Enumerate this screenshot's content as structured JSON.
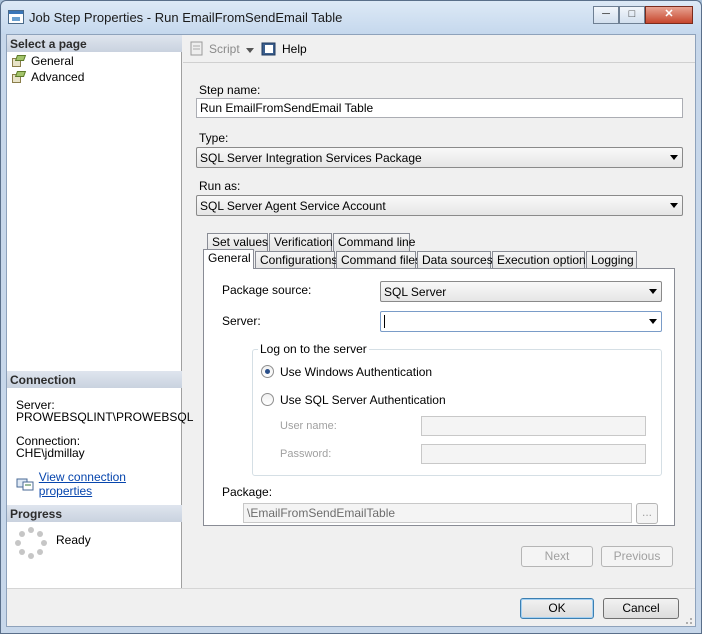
{
  "window": {
    "title": "Job Step Properties - Run EmailFromSendEmail Table"
  },
  "left": {
    "select_page_header": "Select a page",
    "pages": [
      {
        "label": "General"
      },
      {
        "label": "Advanced"
      }
    ],
    "connection_header": "Connection",
    "server_label": "Server:",
    "server_value": "PROWEBSQLINT\\PROWEBSQL",
    "connection_label": "Connection:",
    "connection_value": "CHE\\jdmillay",
    "view_connection_properties": "View connection properties",
    "progress_header": "Progress",
    "progress_status": "Ready"
  },
  "toolbar": {
    "script_label": "Script",
    "help_label": "Help"
  },
  "form": {
    "step_name_label": "Step name:",
    "step_name_value": "Run EmailFromSendEmail Table",
    "type_label": "Type:",
    "type_value": "SQL Server Integration Services Package",
    "run_as_label": "Run as:",
    "run_as_value": "SQL Server Agent Service Account"
  },
  "tabs": {
    "row1": [
      "Set values",
      "Verification",
      "Command line"
    ],
    "row2": [
      "General",
      "Configurations",
      "Command files",
      "Data sources",
      "Execution options",
      "Logging"
    ]
  },
  "general": {
    "package_source_label": "Package source:",
    "package_source_value": "SQL Server",
    "server_label": "Server:",
    "server_value": "",
    "logon_group": "Log on to the server",
    "use_windows_auth": "Use Windows Authentication",
    "use_sql_auth": "Use SQL Server Authentication",
    "user_name_label": "User name:",
    "password_label": "Password:",
    "package_label": "Package:",
    "package_value": "\\EmailFromSendEmailTable",
    "browse_label": "..."
  },
  "nav_buttons": {
    "next": "Next",
    "previous": "Previous"
  },
  "dialog_buttons": {
    "ok": "OK",
    "cancel": "Cancel"
  }
}
